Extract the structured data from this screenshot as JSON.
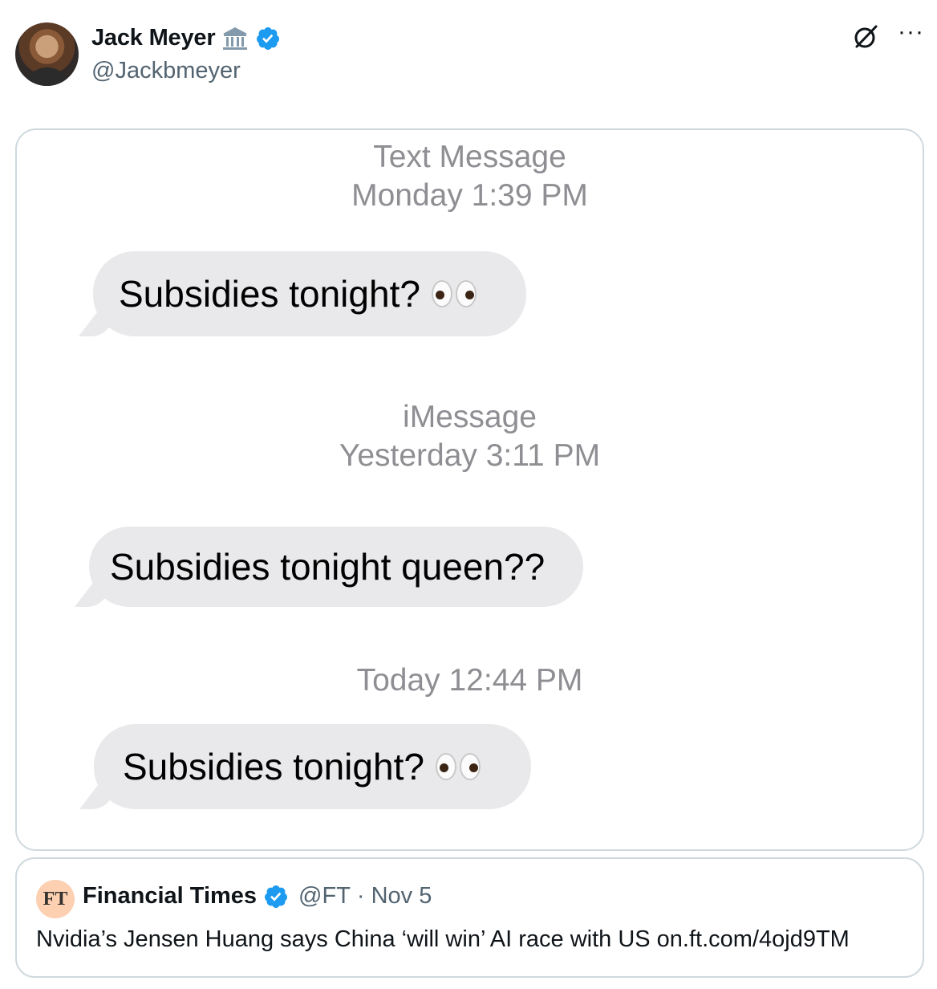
{
  "author": {
    "name": "Jack Meyer",
    "handle": "@Jackbmeyer"
  },
  "icons": {
    "government_badge": "classical-building-icon",
    "verified": "verified-badge-icon",
    "grok": "grok-icon",
    "more": "more-icon"
  },
  "colors": {
    "verified_blue": "#1d9bf0",
    "bubble_gray": "#e9e9eb",
    "timestamp_gray": "#8e8e93",
    "secondary_text": "#536471"
  },
  "more_glyph": "···",
  "messages": [
    {
      "ts_line1": "Text Message",
      "ts_line2": "Monday 1:39 PM",
      "text": "Subsidies tonight?",
      "emoji": "eyes"
    },
    {
      "ts_line1": "iMessage",
      "ts_line2": "Yesterday 3:11 PM",
      "text": "Subsidies tonight queen??",
      "emoji": ""
    },
    {
      "ts_line1": "",
      "ts_line2": "Today 12:44 PM",
      "text": "Subsidies tonight?",
      "emoji": "eyes"
    }
  ],
  "quote": {
    "logo_text": "FT",
    "name": "Financial Times",
    "handle": "@FT",
    "separator": "·",
    "date": "Nov 5",
    "text": "Nvidia’s Jensen Huang says China ‘will win’ AI race with US on.ft.com/4ojd9TM"
  }
}
